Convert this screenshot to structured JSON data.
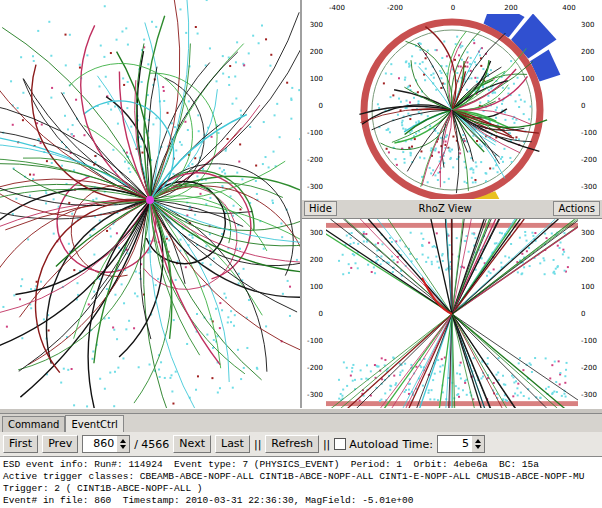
{
  "rphi_view": {
    "x_ticks": [
      "-400",
      "-200",
      "0",
      "200",
      "400"
    ],
    "y_ticks": [
      "300",
      "200",
      "100",
      "0",
      "-100",
      "-200",
      "-300"
    ]
  },
  "rhoz_bar": {
    "hide": "Hide",
    "title": "RhoZ View",
    "actions": "Actions"
  },
  "rhoz_view": {
    "y_ticks": [
      "300",
      "200",
      "100",
      "0",
      "-100",
      "-200",
      "-300"
    ]
  },
  "tabs": [
    {
      "label": "Command",
      "selected": false
    },
    {
      "label": "EventCtrl",
      "selected": true
    }
  ],
  "toolbar": [
    {
      "kind": "button",
      "label": "First"
    },
    {
      "kind": "button",
      "label": "Prev"
    },
    {
      "kind": "spinner",
      "label": "860"
    },
    {
      "kind": "label",
      "label": "/ 4566"
    },
    {
      "kind": "button",
      "label": "Next"
    },
    {
      "kind": "button",
      "label": "Last"
    },
    {
      "kind": "separator",
      "label": "||"
    },
    {
      "kind": "button",
      "label": "Refresh"
    },
    {
      "kind": "separator",
      "label": "||"
    },
    {
      "kind": "checkbox",
      "label": "Autoload",
      "checked": false
    },
    {
      "kind": "label",
      "label": "Time:"
    },
    {
      "kind": "spinner",
      "label": "5"
    }
  ],
  "info_lines": [
    "ESD event info: Run#: 114924  Event type: 7 (PHYSICS_EVENT)  Period: 1  Orbit: 4ebe6a  BC: 15a",
    "Active trigger classes: CBEAMB-ABCE-NOPF-ALL CINT1B-ABCE-NOPF-ALL CINT1-E-NOPF-ALL CMUS1B-ABCE-NOPF-MU",
    "Trigger: 2 ( CINT1B-ABCE-NOPF-ALL )",
    "Event# in file: 860  Timestamp: 2010-03-31 22:36:30, MagField: -5.01e+00"
  ]
}
